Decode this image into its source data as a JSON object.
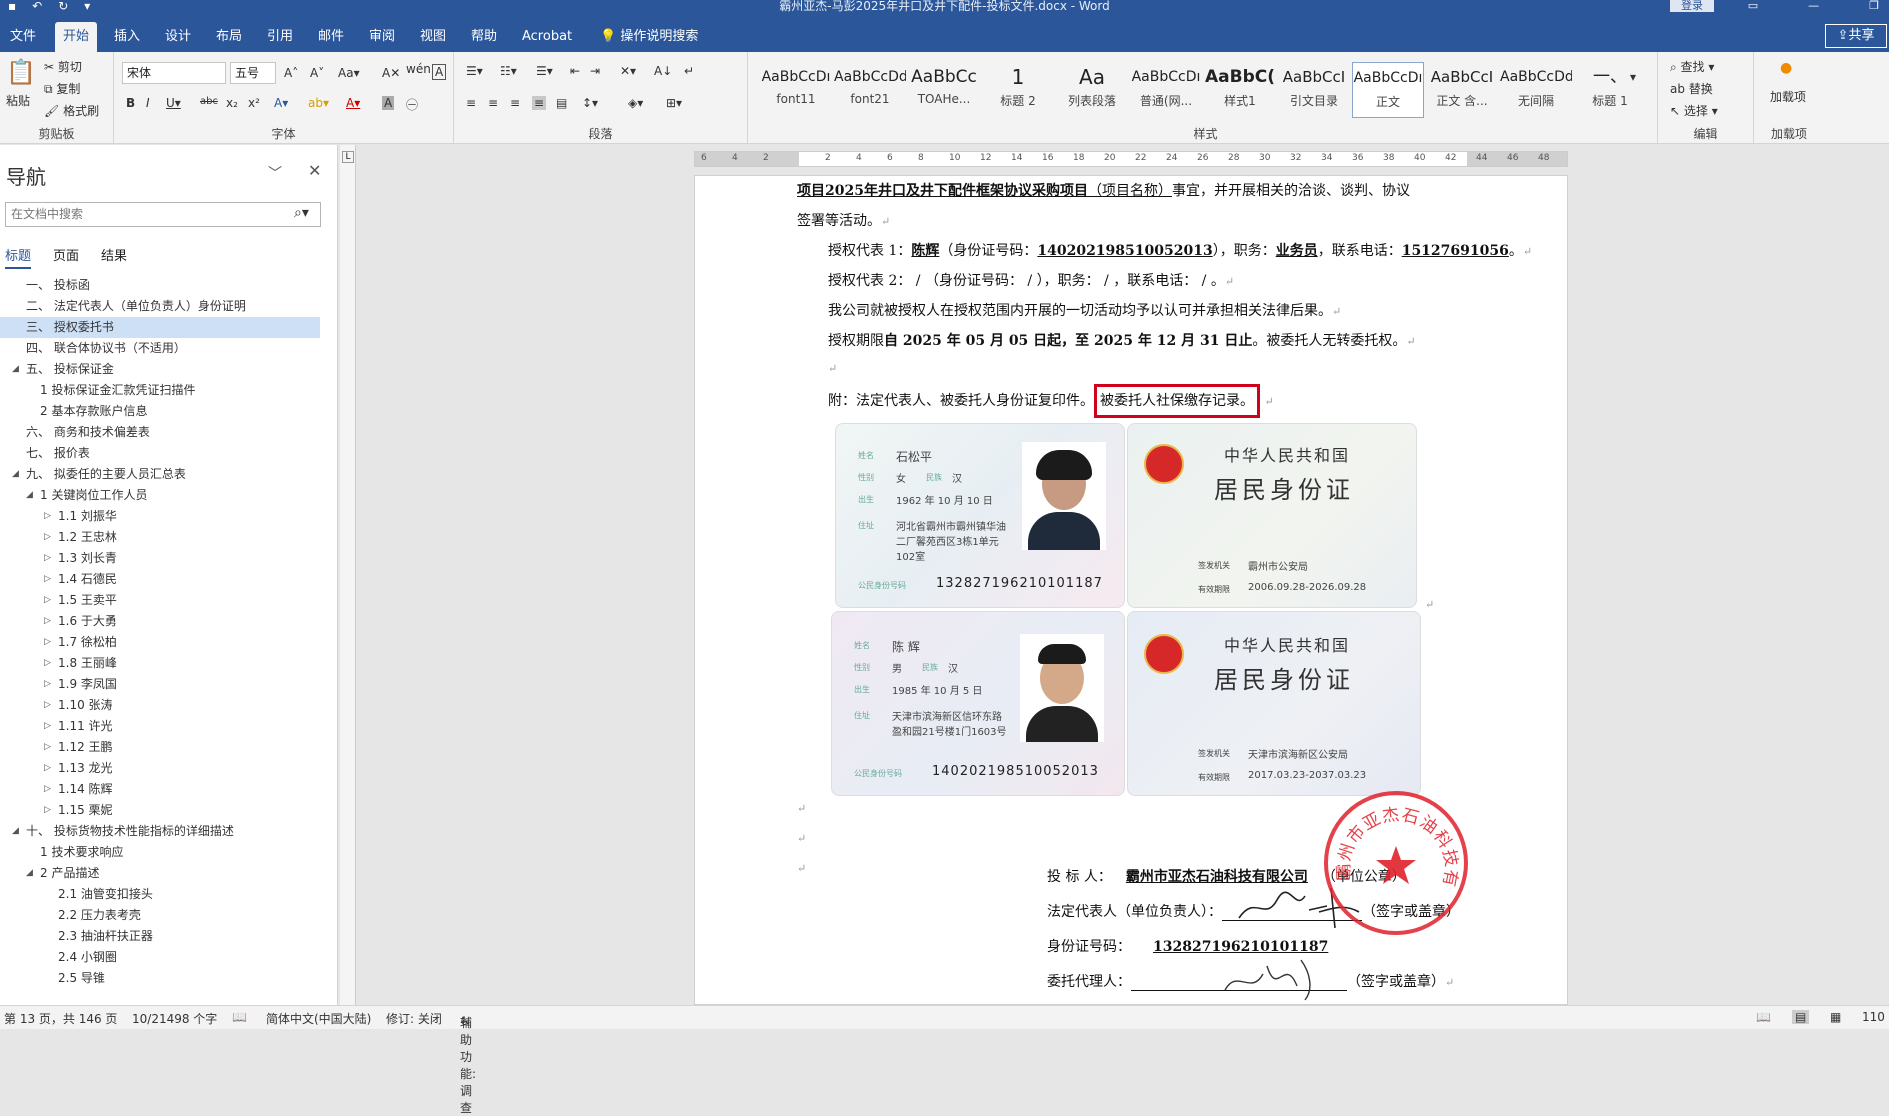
{
  "title_bar": {
    "title": "霸州亚杰-马彭2025年井口及井下配件-投标文件.docx - Word",
    "login": "登录"
  },
  "tabs": [
    "文件",
    "开始",
    "插入",
    "设计",
    "布局",
    "引用",
    "邮件",
    "审阅",
    "视图",
    "帮助",
    "Acrobat",
    "操作说明搜索"
  ],
  "share": "共享",
  "ribbon": {
    "clipboard": {
      "paste": "粘贴",
      "cut": "剪切",
      "copy": "复制",
      "format_painter": "格式刷",
      "label": "剪贴板"
    },
    "font": {
      "name": "宋体",
      "size": "五号",
      "label": "字体"
    },
    "paragraph": {
      "label": "段落"
    },
    "styles": {
      "items": [
        {
          "preview": "AaBbCcDı",
          "name": "font11"
        },
        {
          "preview": "AaBbCcDdI",
          "name": "font21"
        },
        {
          "preview": "AaBbCc",
          "name": "TOAHe..."
        },
        {
          "preview": "1",
          "name": "标题 2"
        },
        {
          "preview": "Aa",
          "name": "列表段落"
        },
        {
          "preview": "AaBbCcDı",
          "name": "普通(网..."
        },
        {
          "preview": "AaBbC(",
          "name": "样式1"
        },
        {
          "preview": "AaBbCcI",
          "name": "引文目录"
        },
        {
          "preview": "AaBbCcDı",
          "name": "正文"
        },
        {
          "preview": "AaBbCcI",
          "name": "正文 含..."
        },
        {
          "preview": "AaBbCcDdI",
          "name": "无间隔"
        },
        {
          "preview": "一、",
          "name": "标题 1"
        }
      ],
      "label": "样式"
    },
    "editing": {
      "find": "查找",
      "replace": "替换",
      "select": "选择",
      "label": "编辑"
    },
    "addins": {
      "load": "加载项",
      "label": "加载项"
    }
  },
  "nav": {
    "title": "导航",
    "search_placeholder": "在文档中搜索",
    "tabs": [
      "标题",
      "页面",
      "结果"
    ],
    "items": [
      {
        "text": "一、 投标函",
        "level": 1
      },
      {
        "text": "二、 法定代表人（单位负责人）身份证明",
        "level": 1
      },
      {
        "text": "三、 授权委托书",
        "level": 1,
        "selected": true
      },
      {
        "text": "四、 联合体协议书（不适用）",
        "level": 1
      },
      {
        "text": "五、 投标保证金",
        "level": 1,
        "expand": true
      },
      {
        "text": "1 投标保证金汇款凭证扫描件",
        "level": 2
      },
      {
        "text": "2 基本存款账户信息",
        "level": 2
      },
      {
        "text": "六、 商务和技术偏差表",
        "level": 1
      },
      {
        "text": "七、 报价表",
        "level": 1
      },
      {
        "text": "九、 拟委任的主要人员汇总表",
        "level": 1,
        "expand": true
      },
      {
        "text": "1 关键岗位工作人员",
        "level": 2,
        "expand": true
      },
      {
        "text": "1.1 刘振华",
        "level": 3,
        "child": true
      },
      {
        "text": "1.2 王忠林",
        "level": 3,
        "child": true
      },
      {
        "text": "1.3 刘长青",
        "level": 3,
        "child": true
      },
      {
        "text": "1.4 石德民",
        "level": 3,
        "child": true
      },
      {
        "text": "1.5 王卖平",
        "level": 3,
        "child": true
      },
      {
        "text": "1.6 于大勇",
        "level": 3,
        "child": true
      },
      {
        "text": "1.7 徐松柏",
        "level": 3,
        "child": true
      },
      {
        "text": "1.8 王丽峰",
        "level": 3,
        "child": true
      },
      {
        "text": "1.9 李凤国",
        "level": 3,
        "child": true
      },
      {
        "text": "1.10 张涛",
        "level": 3,
        "child": true
      },
      {
        "text": "1.11 许光",
        "level": 3,
        "child": true
      },
      {
        "text": "1.12 王鹏",
        "level": 3,
        "child": true
      },
      {
        "text": "1.13 龙光",
        "level": 3,
        "child": true
      },
      {
        "text": "1.14 陈辉",
        "level": 3,
        "child": true
      },
      {
        "text": "1.15 栗妮",
        "level": 3,
        "child": true
      },
      {
        "text": "十、 投标货物技术性能指标的详细描述",
        "level": 1,
        "expand": true
      },
      {
        "text": "1 技术要求响应",
        "level": 2
      },
      {
        "text": "2 产品描述",
        "level": 2,
        "expand": true
      },
      {
        "text": "2.1 油管变扣接头",
        "level": 3
      },
      {
        "text": "2.2 压力表考壳",
        "level": 3
      },
      {
        "text": "2.3 抽油杆扶正器",
        "level": 3
      },
      {
        "text": "2.4 小钢圈",
        "level": 3
      },
      {
        "text": "2.5 导锥",
        "level": 3
      }
    ]
  },
  "ruler": [
    "6",
    "4",
    "2",
    "",
    "2",
    "4",
    "6",
    "8",
    "10",
    "12",
    "14",
    "16",
    "18",
    "20",
    "22",
    "24",
    "26",
    "28",
    "30",
    "32",
    "34",
    "36",
    "38",
    "40",
    "42",
    "44",
    "46",
    "48"
  ],
  "doc": {
    "line1a": "项目2025年井口及井下配件框架协议采购项目",
    "line1b": "（项目名称）",
    "line1c": "事宜，并开展相关的洽谈、谈判、协议",
    "line2": "签署等活动。",
    "rep1_pre": "授权代表 1：",
    "rep1_name": "陈辉",
    "rep1_id_pre": "（身份证号码：",
    "rep1_id": "140202198510052013",
    "rep1_mid": "），职务：",
    "rep1_pos": "业务员",
    "rep1_tel_pre": "，联系电话：",
    "rep1_tel": "15127691056",
    "rep1_end": "。",
    "rep2": "授权代表 2：   /    （身份证号码：        /        ），职务：   /   ，联系电话：     /     。",
    "recognize": "我公司就被授权人在授权范围内开展的一切活动均予以认可并承担相关法律后果。",
    "period_pre": "授权期限",
    "period": "自 2025 年 05 月 05 日起，至 2025 年 12 月 31 日止",
    "period_end": "。被委托人无转委托权。",
    "attach_pre": "附：法定代表人、被委托人身份证复印件。",
    "attach_box": "被委托人社保缴存记录。",
    "sig_bidder_label": "投  标  人：",
    "sig_bidder": "霸州市亚杰石油科技有限公司",
    "sig_bidder_note": "（单位公章）",
    "sig_legal_label": "法定代表人（单位负责人）：",
    "sig_legal_note": "（签字或盖章）",
    "sig_id_label": "身份证号码：",
    "sig_id": "132827196210101187",
    "sig_agent_label": "委托代理人：",
    "sig_agent_note": "（签字或盖章）"
  },
  "id_cards": {
    "card1": {
      "name": "石松平",
      "sex": "女",
      "nation": "汉",
      "birth": "1962 年 10 月 10 日",
      "addr1": "河北省霸州市霸州镇华油",
      "addr2": "二厂馨苑西区3栋1单元",
      "addr3": "102室",
      "number": "132827196210101187"
    },
    "card1_back": {
      "country": "中华人民共和国",
      "doc": "居民身份证",
      "issuer": "霸州市公安局",
      "valid": "2006.09.28-2026.09.28"
    },
    "card2": {
      "name": "陈 辉",
      "sex": "男",
      "nation": "汉",
      "birth": "1985 年 10 月 5 日",
      "addr1": "天津市滨海新区信环东路",
      "addr2": "盈和园21号楼1门1603号",
      "number": "140202198510052013"
    },
    "card2_back": {
      "country": "中华人民共和国",
      "doc": "居民身份证",
      "issuer": "天津市滨海新区公安局",
      "valid": "2017.03.23-2037.03.23"
    },
    "labels": {
      "name": "姓名",
      "sex": "性别",
      "nation": "民族",
      "birth": "出生",
      "addr": "住址",
      "number": "公民身份号码",
      "issuer": "签发机关",
      "valid": "有效期限"
    }
  },
  "seal": {
    "text": "霸州市亚杰石油科技有限公司"
  },
  "status": {
    "page": "第 13 页，共 146 页",
    "words": "10/21498 个字",
    "lang": "简体中文(中国大陆)",
    "track": "修订: 关闭",
    "access": "辅助功能: 调查",
    "zoom": "110"
  },
  "colors": {
    "accent": "#2b579a",
    "highlight_box": "#d0021b",
    "seal": "#e0202a",
    "nav_selected": "#cde0f6"
  }
}
